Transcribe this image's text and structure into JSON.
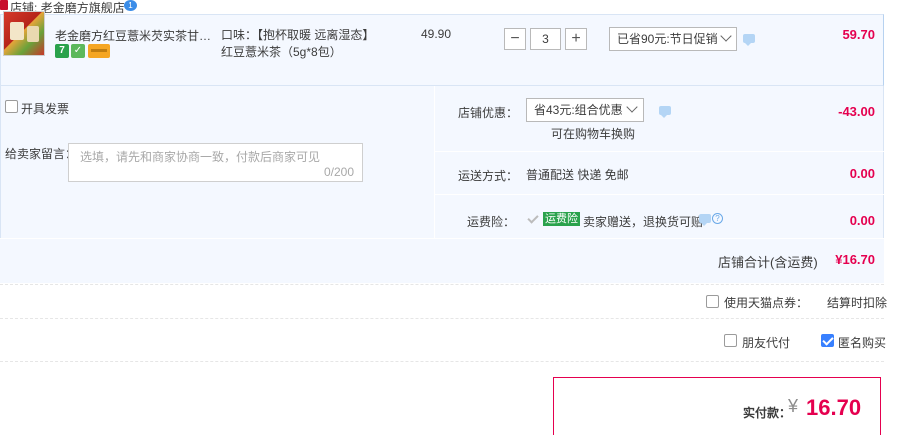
{
  "shop": {
    "label": "店铺:",
    "name": "老金磨方旗舰店",
    "badge": "1"
  },
  "item": {
    "title": "老金磨方红豆薏米芡实茶甘草茯...",
    "sku": "口味：【抱杯取暖 远离湿态】红豆薏米茶（5g*8包）",
    "unit_price": "49.90",
    "quantity": "3",
    "qty_minus": "−",
    "qty_plus": "+",
    "promo_selected": "已省90元:节日促销",
    "total": "59.70",
    "service_icons": [
      "7-day-return-icon",
      "guarantee-icon",
      "card-pay-icon"
    ]
  },
  "invoice": {
    "label": "开具发票",
    "checked": false
  },
  "message": {
    "label": "给卖家留言：",
    "placeholder": "选填，请先和商家协商一致，付款后商家可见",
    "count": "0/200"
  },
  "shop_discount": {
    "label": "店铺优惠：",
    "selected": "省43元:组合优惠",
    "note": "可在购物车换购",
    "value": "-43.00"
  },
  "shipping": {
    "label": "运送方式：",
    "method": "普通配送 快递 免邮",
    "value": "0.00"
  },
  "freight_insurance": {
    "label": "运费险：",
    "tag": "运费险",
    "desc": "卖家赠送，退换货可赔",
    "value": "0.00"
  },
  "shop_total": {
    "label": "店铺合计(含运费)",
    "value": "¥16.70"
  },
  "tmall_points": {
    "label": "使用天猫点券：",
    "note": "结算时扣除",
    "checked": false
  },
  "options": {
    "friend_pay": {
      "label": "朋友代付",
      "checked": false
    },
    "anonymous": {
      "label": "匿名购买",
      "checked": true
    }
  },
  "payment": {
    "label": "实付款：",
    "currency": "¥",
    "amount": "16.70"
  },
  "colors": {
    "accent_red": "#e5004f",
    "panel_bg": "#f4f8ff",
    "blue": "#3880ff",
    "green_tag": "#2aa24c"
  }
}
